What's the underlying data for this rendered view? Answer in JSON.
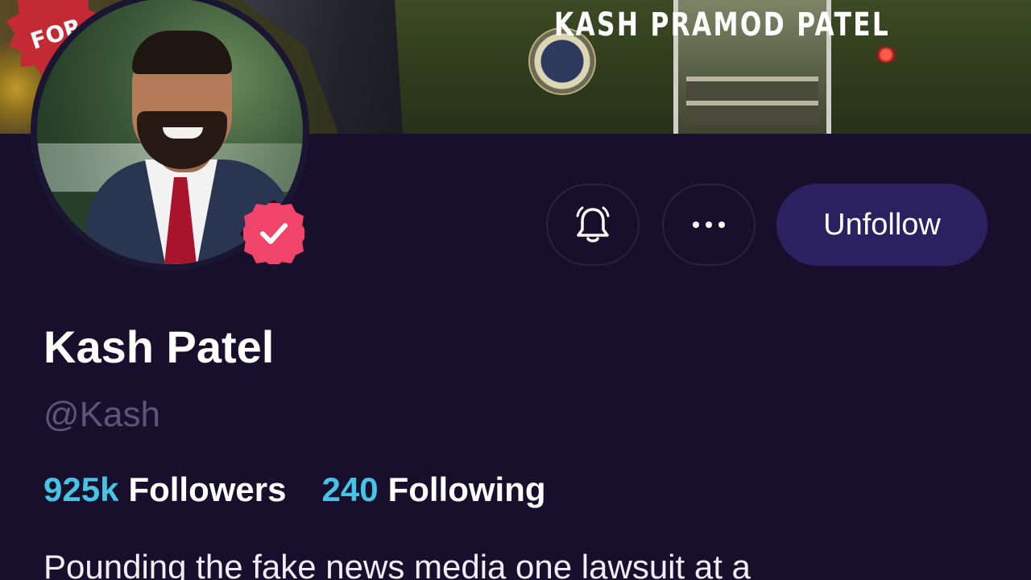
{
  "banner": {
    "title": "KASH PRAMOD PATEL",
    "stamp_text": "FOR"
  },
  "profile": {
    "name": "Kash Patel",
    "handle": "@Kash",
    "verified_icon": "verified-check-icon",
    "bio": "Pounding the fake news media one lawsuit at a"
  },
  "actions": {
    "notify_icon": "bell-icon",
    "more_icon": "more-horizontal-icon",
    "unfollow_label": "Unfollow"
  },
  "stats": {
    "followers_count": "925k",
    "followers_label": "Followers",
    "following_count": "240",
    "following_label": "Following"
  },
  "colors": {
    "background": "#170f2c",
    "accent_count": "#46c4e6",
    "unfollow_button": "#2b2160",
    "verified_badge": "#f0446a",
    "handle_text": "#5d5577"
  }
}
